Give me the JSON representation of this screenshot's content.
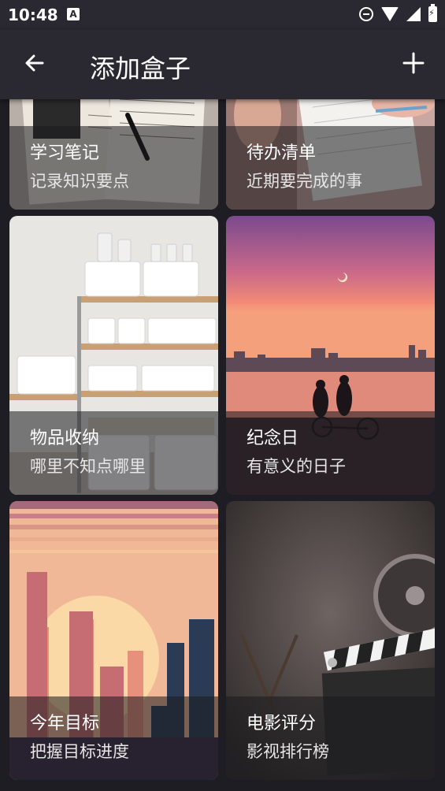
{
  "status": {
    "time": "10:48",
    "a_badge": "A"
  },
  "header": {
    "title": "添加盒子"
  },
  "cards": [
    {
      "title": "学习笔记",
      "subtitle": "记录知识要点",
      "image": "open-notebook-with-pen-photo"
    },
    {
      "title": "待办清单",
      "subtitle": "近期要完成的事",
      "image": "hand-writing-on-spiral-notepad-photo"
    },
    {
      "title": "物品收纳",
      "subtitle": "哪里不知点哪里",
      "image": "white-storage-bins-on-shelf-photo"
    },
    {
      "title": "纪念日",
      "subtitle": "有意义的日子",
      "image": "couple-on-tandem-bike-at-sunset-photo"
    },
    {
      "title": "今年目标",
      "subtitle": "把握目标进度",
      "image": "city-skyline-sunset-illustration"
    },
    {
      "title": "电影评分",
      "subtitle": "影视排行榜",
      "image": "film-clapperboard-and-director-chair-photo"
    }
  ]
}
